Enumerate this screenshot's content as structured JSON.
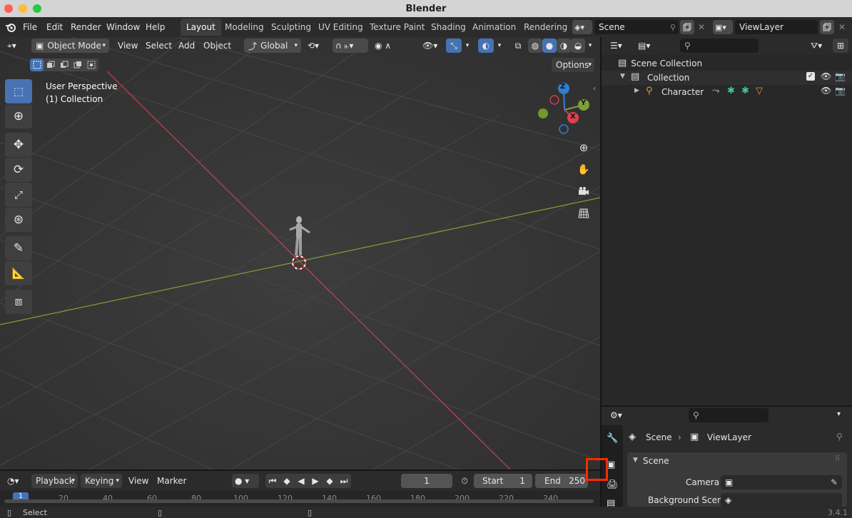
{
  "window": {
    "title": "Blender",
    "version": "3.4.1"
  },
  "menubar": {
    "items": [
      "File",
      "Edit",
      "Render",
      "Window",
      "Help"
    ]
  },
  "workspaces": [
    "Layout",
    "Modeling",
    "Sculpting",
    "UV Editing",
    "Texture Paint",
    "Shading",
    "Animation",
    "Rendering"
  ],
  "active_workspace": "Layout",
  "scene_field": "Scene",
  "viewlayer_field": "ViewLayer",
  "viewport": {
    "mode": "Object Mode",
    "menus": [
      "View",
      "Select",
      "Add",
      "Object"
    ],
    "orientation": "Global",
    "options_label": "Options",
    "overlay_line1": "User Perspective",
    "overlay_line2": "(1) Collection",
    "gizmo": {
      "z": "Z",
      "y": "Y",
      "x": "X"
    }
  },
  "outliner": {
    "scene_collection": "Scene Collection",
    "collection": "Collection",
    "character": "Character"
  },
  "properties": {
    "breadcrumb_scene": "Scene",
    "breadcrumb_viewlayer": "ViewLayer",
    "panel_title": "Scene",
    "camera_label": "Camera",
    "background_label": "Background Scene"
  },
  "timeline": {
    "menus": [
      "Playback",
      "Keying",
      "View",
      "Marker"
    ],
    "current_frame": "1",
    "start_label": "Start",
    "start_value": "1",
    "end_label": "End",
    "end_value": "250",
    "ticks": [
      "20",
      "40",
      "60",
      "80",
      "100",
      "120",
      "140",
      "160",
      "180",
      "200",
      "220",
      "240"
    ],
    "current_marker": "1"
  },
  "statusbar": {
    "select_label": "Select"
  },
  "colors": {
    "accent": "#4772b3",
    "x_axis": "#c6424f",
    "y_axis": "#7fa035",
    "z_axis": "#2f7fd1",
    "highlight": "#ff2a00"
  }
}
